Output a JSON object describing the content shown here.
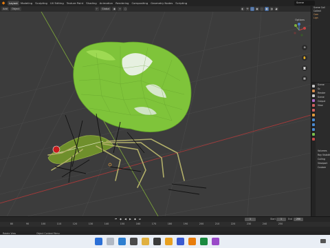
{
  "app": {
    "scene_name": "Scene",
    "accent": "#e87d0d"
  },
  "workspace_tabs": [
    "Layout",
    "Modeling",
    "Sculpting",
    "UV Editing",
    "Texture Paint",
    "Shading",
    "Animation",
    "Rendering",
    "Compositing",
    "Geometry Nodes",
    "Scripting"
  ],
  "viewport_header": {
    "mode": "Add",
    "object_menu": "Object",
    "transform_orientation": "Global",
    "options_label": "Options"
  },
  "outliner": {
    "rows": [
      "Scene Coll",
      "Collect",
      "Cam",
      "Ligh"
    ]
  },
  "properties": {
    "rows": [
      "Scene",
      "Sc",
      "Render",
      "Scene",
      "Output",
      "View",
      "Volumes",
      "Ray Visibility",
      "Culling",
      "Viewport",
      "Custom"
    ]
  },
  "timeline": {
    "ticks": [
      "80",
      "90",
      "100",
      "110",
      "120",
      "130",
      "140",
      "150",
      "160",
      "170",
      "180",
      "190",
      "200",
      "210",
      "220",
      "230",
      "240",
      "250"
    ],
    "current_frame": "1",
    "start_label": "Start",
    "start_value": "1",
    "end_label": "End",
    "end_value": "250"
  },
  "statusbar": {
    "left": "Rotate View",
    "middle": "Object Context Menu"
  },
  "colors": {
    "viewport_bg": "#3c3c3c",
    "mesh_green": "#7fc43a",
    "grid_line": "#4a4a4a",
    "x_axis": "#a83a3a",
    "y_axis": "#7aa13a"
  }
}
